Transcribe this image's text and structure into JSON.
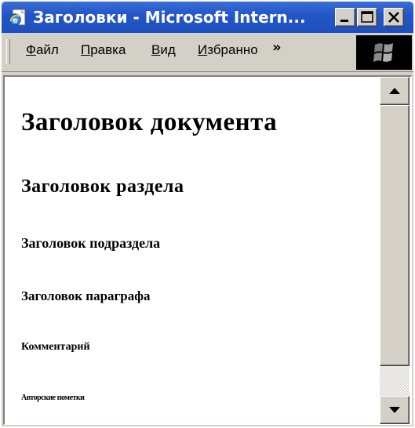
{
  "window": {
    "title": "Заголовки - Microsoft Intern...",
    "icon": "ie-page-icon",
    "buttons": [
      "minimize-icon",
      "maximize-icon",
      "close-icon"
    ]
  },
  "menu": {
    "file": {
      "accel": "Ф",
      "rest": "айл"
    },
    "edit": {
      "accel": "П",
      "rest": "равка"
    },
    "view": {
      "accel": "В",
      "rest": "ид"
    },
    "favorites": {
      "accel": "И",
      "rest": "збранно"
    },
    "more": "»"
  },
  "document": {
    "h1": "Заголовок документа",
    "h2": "Заголовок раздела",
    "h3": "Заголовок подраздела",
    "h4": "Заголовок параграфа",
    "h5": "Комментарий",
    "h6": "Авторские пометки"
  },
  "colors": {
    "titlebar": "#2356c8",
    "chrome": "#d4d0c8",
    "content_bg": "#ffffff"
  }
}
